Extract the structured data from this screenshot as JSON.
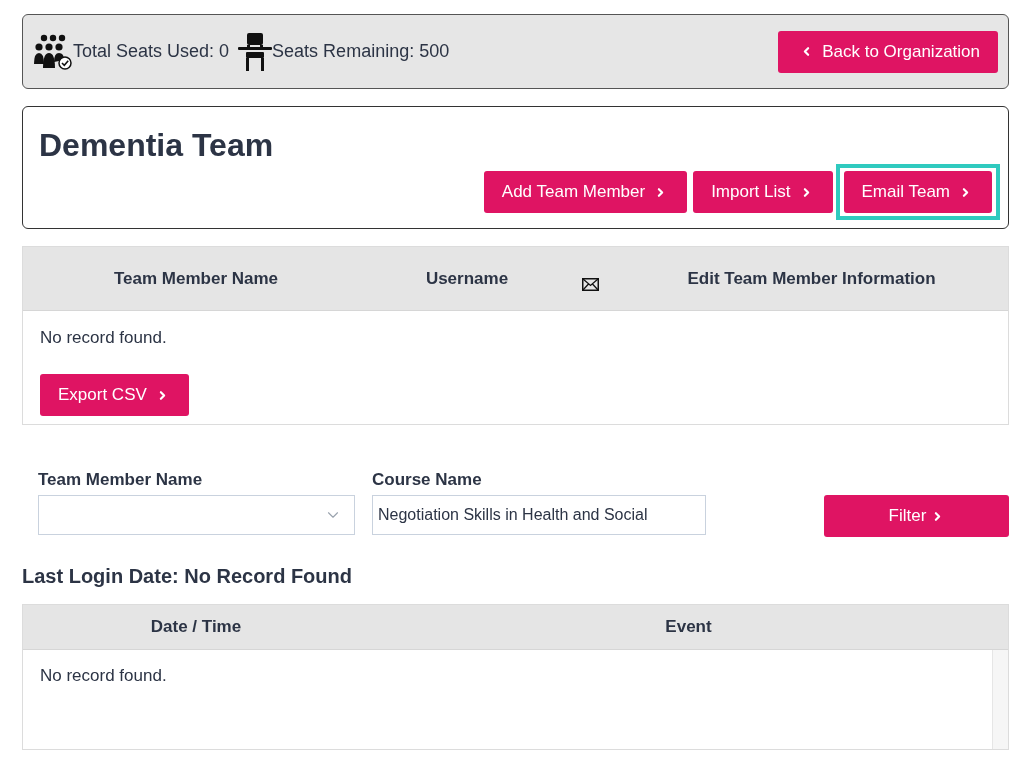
{
  "seats_bar": {
    "stats": [
      {
        "kind": "used",
        "label": "Total Seats Used: 0"
      },
      {
        "kind": "remaining",
        "label": "Seats Remaining: 500"
      }
    ],
    "back_button": "Back to Organization"
  },
  "team": {
    "title": "Dementia Team",
    "buttons": [
      {
        "label": "Add Team Member",
        "highlighted": false
      },
      {
        "label": "Import List",
        "highlighted": false
      },
      {
        "label": "Email Team",
        "highlighted": true
      }
    ]
  },
  "members_table": {
    "columns": [
      {
        "kind": "text",
        "label": "Team Member Name"
      },
      {
        "kind": "text",
        "label": "Username"
      },
      {
        "kind": "envelope"
      },
      {
        "kind": "text",
        "label": "Edit Team Member Information"
      }
    ],
    "empty_message": "No record found.",
    "export_button": "Export CSV"
  },
  "filters": {
    "fields": [
      {
        "kind": "select",
        "label": "Team Member Name"
      },
      {
        "kind": "text",
        "label": "Course Name",
        "value": "Negotiation Skills in Health and Social"
      }
    ],
    "filter_button": "Filter"
  },
  "last_login": "Last Login Date: No Record Found",
  "login_table": {
    "columns": [
      {
        "kind": "text",
        "label": "Date / Time"
      },
      {
        "kind": "text",
        "label": "Event"
      }
    ],
    "empty_message": "No record found."
  }
}
